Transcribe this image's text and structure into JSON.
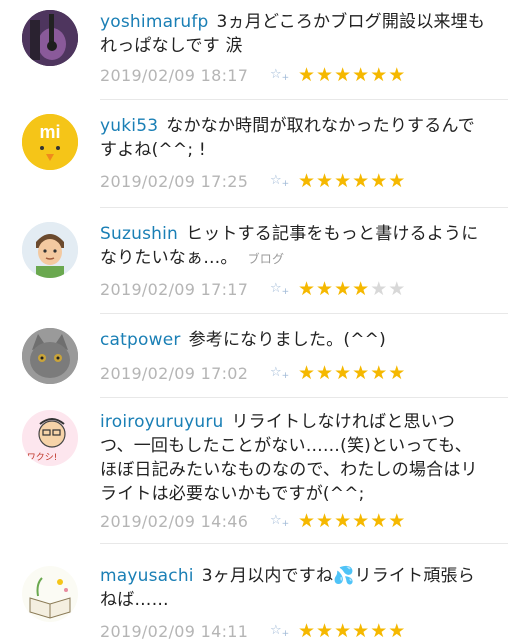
{
  "comments": [
    {
      "user": "yoshimarufp",
      "text": "3ヵ月どころかブログ開設以来埋もれっぱなしです 涙",
      "tag": "",
      "time": "2019/02/09 18:17",
      "stars_filled": 6,
      "stars_total": 6,
      "avatar": "guitar-avatar"
    },
    {
      "user": "yuki53",
      "text": "なかなか時間が取れなかったりするんですよね(^^; !",
      "tag": "",
      "time": "2019/02/09 17:25",
      "stars_filled": 6,
      "stars_total": 6,
      "avatar": "mi-chick-avatar"
    },
    {
      "user": "Suzushin",
      "text": "ヒットする記事をもっと書けるようになりたいなぁ…。",
      "tag": "ブログ",
      "time": "2019/02/09 17:17",
      "stars_filled": 4,
      "stars_total": 6,
      "avatar": "man-avatar"
    },
    {
      "user": "catpower",
      "text": "参考になりました。(^^)",
      "tag": "",
      "time": "2019/02/09 17:02",
      "stars_filled": 6,
      "stars_total": 6,
      "avatar": "cat-avatar"
    },
    {
      "user": "iroiroyuruyuru",
      "text": "リライトしなければと思いつつ、一回もしたことがない……(笑)といっても、ほぼ日記みたいなものなので、わたしの場合はリライトは必要ないかもですが(^^;",
      "tag": "",
      "time": "2019/02/09 14:46",
      "stars_filled": 6,
      "stars_total": 6,
      "avatar": "drawing-avatar",
      "avatar_text": "ワクシ!"
    },
    {
      "user": "mayusachi",
      "text": "3ヶ月以内ですね💦リライト頑張らねば……",
      "tag": "",
      "time": "2019/02/09 14:11",
      "stars_filled": 6,
      "stars_total": 6,
      "avatar": "book-avatar"
    }
  ],
  "add_star_icon": "add-star-icon",
  "colors": {
    "username": "#1a7fb5",
    "timestamp": "#b5b5b5",
    "star": "#f5b800",
    "star_empty": "#d8d8d8"
  }
}
